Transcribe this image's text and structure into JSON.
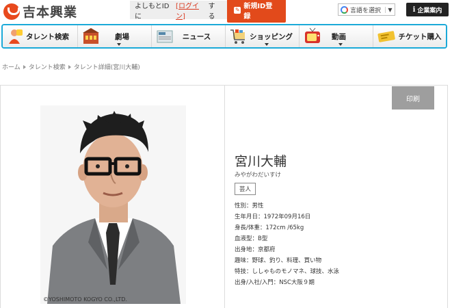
{
  "header": {
    "logo_text": "吉本興業",
    "login_prefix": "よしもとIDに",
    "login_link": "[ログイン]",
    "login_suffix": "する",
    "register_label": "新規ID登録",
    "lang_label": "言語を選択",
    "lang_arrow": "▼",
    "corp_label": "企業案内"
  },
  "nav": {
    "items": [
      {
        "label": "タレント検索",
        "icon": "talent-icon",
        "has_dropdown": false
      },
      {
        "label": "劇場",
        "icon": "theater-icon",
        "has_dropdown": true
      },
      {
        "label": "ニュース",
        "icon": "news-icon",
        "has_dropdown": false
      },
      {
        "label": "ショッピング",
        "icon": "cart-icon",
        "has_dropdown": true
      },
      {
        "label": "動画",
        "icon": "tv-icon",
        "has_dropdown": true
      },
      {
        "label": "チケット購入",
        "icon": "ticket-icon",
        "has_dropdown": false
      }
    ]
  },
  "breadcrumb": [
    "ホーム",
    "タレント検索",
    "タレント詳細(宮川大輔)"
  ],
  "profile": {
    "print_label": "印刷",
    "name": "宮川大輔",
    "kana": "みやがわだいすけ",
    "category": "芸人",
    "copyright": "©YOSHIMOTO KOGYO CO.,LTD.",
    "details": [
      "性別：男性",
      "生年月日：1972年09月16日",
      "身長/体重：172cm /65kg",
      "血液型：B型",
      "出身地：京都府",
      "趣味：野球、釣り、料理、買い物",
      "特技：ししゃものモノマネ、球技、水泳",
      "出身/入社/入門：NSC大阪９期"
    ]
  },
  "colors": {
    "brand_orange": "#e8491d",
    "nav_blue": "#1aa9d8",
    "print_gray": "#9e9e9e"
  }
}
